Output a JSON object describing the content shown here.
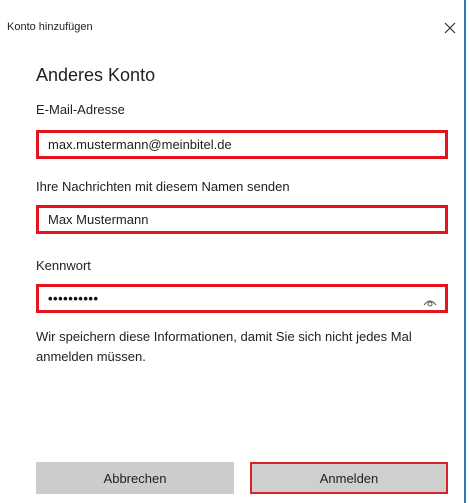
{
  "dialog": {
    "title": "Konto hinzufügen",
    "close_icon": "close-icon",
    "heading": "Anderes Konto"
  },
  "form": {
    "email": {
      "label": "E-Mail-Adresse",
      "value": "max.mustermann@meinbitel.de"
    },
    "display_name": {
      "label": "Ihre Nachrichten mit diesem Namen senden",
      "value": "Max Mustermann"
    },
    "password": {
      "label": "Kennwort",
      "masked_value": "••••••••••",
      "reveal_icon": "eye-icon"
    },
    "info": "Wir speichern diese Informationen, damit Sie sich nicht jedes Mal anmelden müssen."
  },
  "buttons": {
    "cancel_label": "Abbrechen",
    "login_label": "Anmelden"
  },
  "colors": {
    "highlight": "#e3151f",
    "window_border": "#2b7bb9",
    "button_bg": "#cccccc"
  }
}
